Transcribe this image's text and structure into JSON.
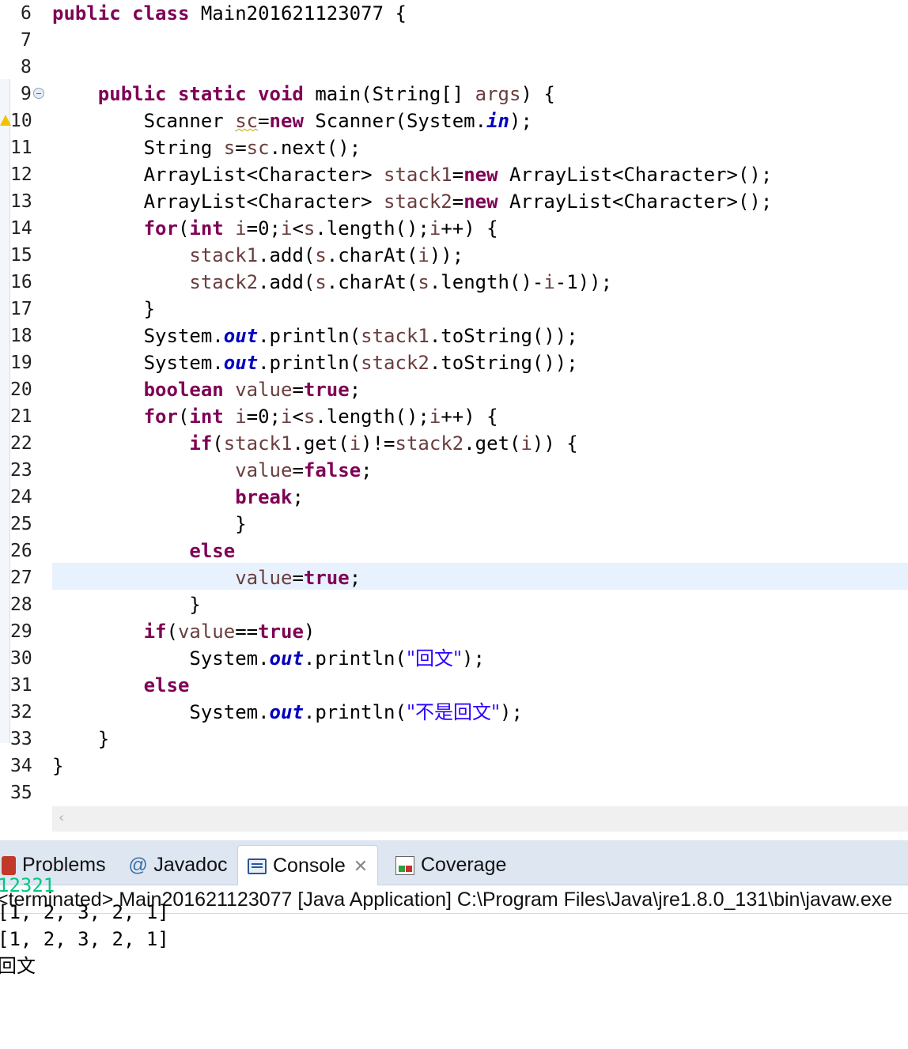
{
  "editor": {
    "lines": [
      {
        "n": "6",
        "segs": [
          [
            "public class ",
            "kw"
          ],
          [
            "Main201621123077 {",
            ""
          ]
        ]
      },
      {
        "n": "7",
        "segs": []
      },
      {
        "n": "8",
        "segs": []
      },
      {
        "n": "9",
        "segs": [
          [
            "    ",
            ""
          ],
          [
            "public static void ",
            "kw"
          ],
          [
            "main(String[] ",
            ""
          ],
          [
            "args",
            "var"
          ],
          [
            ") {",
            ""
          ]
        ],
        "fold": true
      },
      {
        "n": "10",
        "segs": [
          [
            "        Scanner ",
            ""
          ],
          [
            "sc",
            "var warn"
          ],
          [
            "=",
            ""
          ],
          [
            "new ",
            "kw"
          ],
          [
            "Scanner(System.",
            ""
          ],
          [
            "in",
            "fld"
          ],
          [
            ");",
            ""
          ]
        ],
        "warning": true
      },
      {
        "n": "11",
        "segs": [
          [
            "        String ",
            ""
          ],
          [
            "s",
            "var"
          ],
          [
            "=",
            ""
          ],
          [
            "sc",
            "var"
          ],
          [
            ".next();",
            ""
          ]
        ]
      },
      {
        "n": "12",
        "segs": [
          [
            "        ArrayList<Character> ",
            ""
          ],
          [
            "stack1",
            "var"
          ],
          [
            "=",
            ""
          ],
          [
            "new ",
            "kw"
          ],
          [
            "ArrayList<Character>();",
            ""
          ]
        ]
      },
      {
        "n": "13",
        "segs": [
          [
            "        ArrayList<Character> ",
            ""
          ],
          [
            "stack2",
            "var"
          ],
          [
            "=",
            ""
          ],
          [
            "new ",
            "kw"
          ],
          [
            "ArrayList<Character>();",
            ""
          ]
        ]
      },
      {
        "n": "14",
        "segs": [
          [
            "        ",
            ""
          ],
          [
            "for",
            "kw"
          ],
          [
            "(",
            ""
          ],
          [
            "int ",
            "kw"
          ],
          [
            "i",
            "var"
          ],
          [
            "=0;",
            ""
          ],
          [
            "i",
            "var"
          ],
          [
            "<",
            ""
          ],
          [
            "s",
            "var"
          ],
          [
            ".length();",
            ""
          ],
          [
            "i",
            "var"
          ],
          [
            "++) {",
            ""
          ]
        ]
      },
      {
        "n": "15",
        "segs": [
          [
            "            ",
            ""
          ],
          [
            "stack1",
            "var"
          ],
          [
            ".add(",
            ""
          ],
          [
            "s",
            "var"
          ],
          [
            ".charAt(",
            ""
          ],
          [
            "i",
            "var"
          ],
          [
            "));",
            ""
          ]
        ]
      },
      {
        "n": "16",
        "segs": [
          [
            "            ",
            ""
          ],
          [
            "stack2",
            "var"
          ],
          [
            ".add(",
            ""
          ],
          [
            "s",
            "var"
          ],
          [
            ".charAt(",
            ""
          ],
          [
            "s",
            "var"
          ],
          [
            ".length()-",
            ""
          ],
          [
            "i",
            "var"
          ],
          [
            "-1));",
            ""
          ]
        ]
      },
      {
        "n": "17",
        "segs": [
          [
            "        }",
            ""
          ]
        ]
      },
      {
        "n": "18",
        "segs": [
          [
            "        System.",
            ""
          ],
          [
            "out",
            "fld"
          ],
          [
            ".println(",
            ""
          ],
          [
            "stack1",
            "var"
          ],
          [
            ".toString());",
            ""
          ]
        ]
      },
      {
        "n": "19",
        "segs": [
          [
            "        System.",
            ""
          ],
          [
            "out",
            "fld"
          ],
          [
            ".println(",
            ""
          ],
          [
            "stack2",
            "var"
          ],
          [
            ".toString());",
            ""
          ]
        ]
      },
      {
        "n": "20",
        "segs": [
          [
            "        ",
            ""
          ],
          [
            "boolean ",
            "kw"
          ],
          [
            "value",
            "var"
          ],
          [
            "=",
            ""
          ],
          [
            "true",
            "kw"
          ],
          [
            ";",
            ""
          ]
        ]
      },
      {
        "n": "21",
        "segs": [
          [
            "        ",
            ""
          ],
          [
            "for",
            "kw"
          ],
          [
            "(",
            ""
          ],
          [
            "int ",
            "kw"
          ],
          [
            "i",
            "var"
          ],
          [
            "=0;",
            ""
          ],
          [
            "i",
            "var"
          ],
          [
            "<",
            ""
          ],
          [
            "s",
            "var"
          ],
          [
            ".length();",
            ""
          ],
          [
            "i",
            "var"
          ],
          [
            "++) {",
            ""
          ]
        ]
      },
      {
        "n": "22",
        "segs": [
          [
            "            ",
            ""
          ],
          [
            "if",
            "kw"
          ],
          [
            "(",
            ""
          ],
          [
            "stack1",
            "var"
          ],
          [
            ".get(",
            ""
          ],
          [
            "i",
            "var"
          ],
          [
            ")!=",
            ""
          ],
          [
            "stack2",
            "var"
          ],
          [
            ".get(",
            ""
          ],
          [
            "i",
            "var"
          ],
          [
            ")) {",
            ""
          ]
        ]
      },
      {
        "n": "23",
        "segs": [
          [
            "                ",
            ""
          ],
          [
            "value",
            "var"
          ],
          [
            "=",
            ""
          ],
          [
            "false",
            "kw"
          ],
          [
            ";",
            ""
          ]
        ]
      },
      {
        "n": "24",
        "segs": [
          [
            "                ",
            ""
          ],
          [
            "break",
            "kw"
          ],
          [
            ";",
            ""
          ]
        ]
      },
      {
        "n": "25",
        "segs": [
          [
            "                }",
            ""
          ]
        ]
      },
      {
        "n": "26",
        "segs": [
          [
            "            ",
            ""
          ],
          [
            "else",
            "kw"
          ]
        ]
      },
      {
        "n": "27",
        "segs": [
          [
            "                ",
            ""
          ],
          [
            "value",
            "var"
          ],
          [
            "=",
            ""
          ],
          [
            "true",
            "kw"
          ],
          [
            ";",
            ""
          ]
        ],
        "current": true
      },
      {
        "n": "28",
        "segs": [
          [
            "            }",
            ""
          ]
        ]
      },
      {
        "n": "29",
        "segs": [
          [
            "        ",
            ""
          ],
          [
            "if",
            "kw"
          ],
          [
            "(",
            ""
          ],
          [
            "value",
            "var"
          ],
          [
            "==",
            ""
          ],
          [
            "true",
            "kw"
          ],
          [
            ")",
            ""
          ]
        ]
      },
      {
        "n": "30",
        "segs": [
          [
            "            System.",
            ""
          ],
          [
            "out",
            "fld"
          ],
          [
            ".println(",
            ""
          ],
          [
            "\"回文\"",
            "str"
          ],
          [
            ");",
            ""
          ]
        ]
      },
      {
        "n": "31",
        "segs": [
          [
            "        ",
            ""
          ],
          [
            "else",
            "kw"
          ]
        ]
      },
      {
        "n": "32",
        "segs": [
          [
            "            System.",
            ""
          ],
          [
            "out",
            "fld"
          ],
          [
            ".println(",
            ""
          ],
          [
            "\"不是回文\"",
            "str"
          ],
          [
            ");",
            ""
          ]
        ]
      },
      {
        "n": "33",
        "segs": [
          [
            "    }",
            ""
          ]
        ]
      },
      {
        "n": "34",
        "segs": [
          [
            "}",
            ""
          ]
        ]
      },
      {
        "n": "35",
        "segs": []
      }
    ],
    "scroll_left_arrow": "‹"
  },
  "views": {
    "tabs": [
      {
        "label": "Problems",
        "icon": "problems-icon"
      },
      {
        "label": "Javadoc",
        "icon": "javadoc-icon"
      },
      {
        "label": "Console",
        "icon": "console-icon",
        "active": true
      },
      {
        "label": "Coverage",
        "icon": "coverage-icon"
      }
    ],
    "console_status": "<terminated> Main201621123077 [Java Application] C:\\Program Files\\Java\\jre1.8.0_131\\bin\\javaw.exe",
    "output": [
      {
        "text": "12321",
        "input": true
      },
      {
        "text": "[1, 2, 3, 2, 1]"
      },
      {
        "text": "[1, 2, 3, 2, 1]"
      },
      {
        "text": "回文"
      }
    ]
  }
}
